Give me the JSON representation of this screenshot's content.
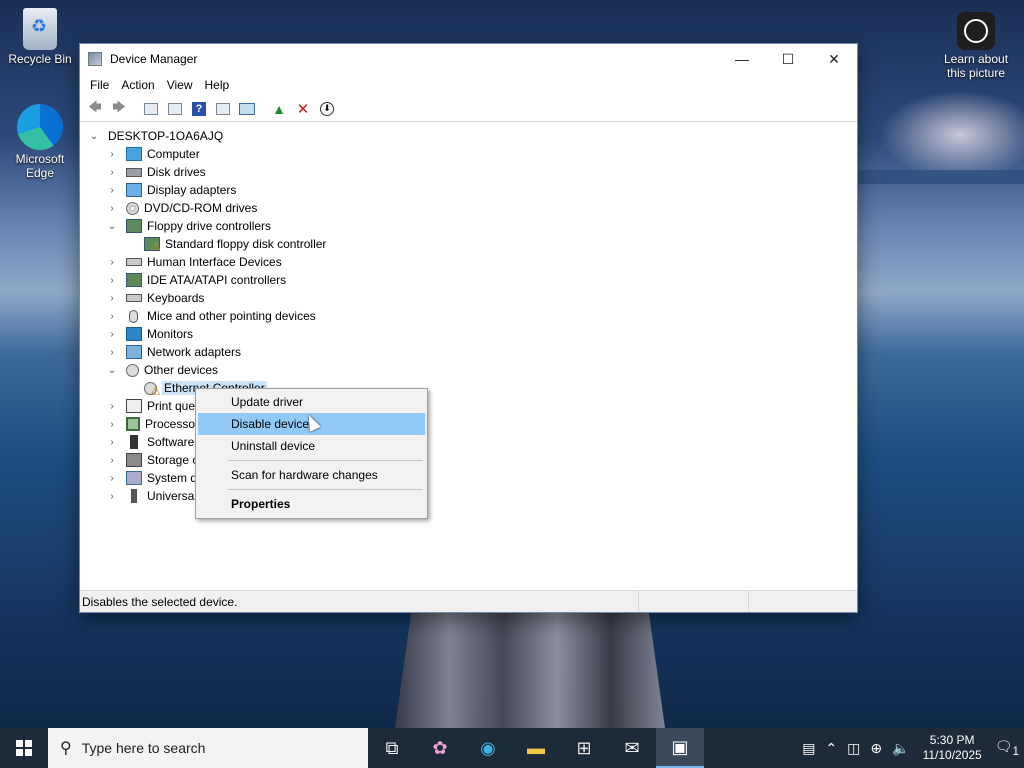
{
  "desktop": {
    "icons": [
      {
        "label": "Recycle Bin"
      },
      {
        "label": "Microsoft Edge"
      },
      {
        "label": "Learn about this picture"
      }
    ]
  },
  "window": {
    "title": "Device Manager",
    "controls": {
      "minimize": "—",
      "maximize": "☐",
      "close": "✕"
    },
    "menu": [
      "File",
      "Action",
      "View",
      "Help"
    ],
    "tree": {
      "root": "DESKTOP-1OA6AJQ",
      "items": [
        {
          "label": "Computer",
          "expanded": false
        },
        {
          "label": "Disk drives",
          "expanded": false
        },
        {
          "label": "Display adapters",
          "expanded": false
        },
        {
          "label": "DVD/CD-ROM drives",
          "expanded": false
        },
        {
          "label": "Floppy drive controllers",
          "expanded": true
        },
        {
          "label": "Standard floppy disk controller",
          "child": true
        },
        {
          "label": "Human Interface Devices",
          "expanded": false
        },
        {
          "label": "IDE ATA/ATAPI controllers",
          "expanded": false
        },
        {
          "label": "Keyboards",
          "expanded": false
        },
        {
          "label": "Mice and other pointing devices",
          "expanded": false
        },
        {
          "label": "Monitors",
          "expanded": false
        },
        {
          "label": "Network adapters",
          "expanded": false
        },
        {
          "label": "Other devices",
          "expanded": true
        },
        {
          "label": "Ethernet Controller",
          "child": true,
          "selected": true
        },
        {
          "label": "Print queues",
          "expanded": false
        },
        {
          "label": "Processors",
          "expanded": false
        },
        {
          "label": "Software devices",
          "expanded": false
        },
        {
          "label": "Storage controllers",
          "expanded": false
        },
        {
          "label": "System devices",
          "expanded": false
        },
        {
          "label": "Universal Serial Bus controllers",
          "expanded": false
        }
      ]
    },
    "status_text": "Disables the selected device."
  },
  "context_menu": {
    "items": [
      {
        "label": "Update driver"
      },
      {
        "label": "Disable device",
        "hover": true
      },
      {
        "label": "Uninstall device"
      },
      {
        "label": "Scan for hardware changes"
      },
      {
        "label": "Properties",
        "bold": true
      }
    ]
  },
  "taskbar": {
    "search_placeholder": "Type here to search",
    "time": "5:30 PM",
    "date": "11/10/2025",
    "notification_count": "1"
  }
}
